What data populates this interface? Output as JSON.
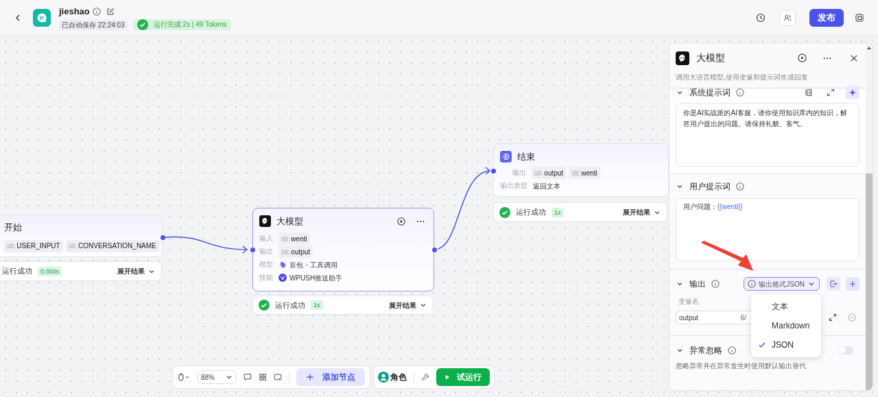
{
  "header": {
    "app_name": "jieshao",
    "autosave": "已自动保存 22:24:03",
    "run_status": "运行完成 2s | 49 Tokens",
    "publish": "发布"
  },
  "start_node": {
    "title": "开始",
    "selected": false,
    "vars": [
      {
        "type": "str.",
        "name": "USER_INPUT"
      },
      {
        "type": "str.",
        "name": "CONVERSATION_NAME"
      }
    ],
    "status": {
      "icon": false,
      "label": "运行成功",
      "time": "0.000s",
      "expand": "展开结果"
    }
  },
  "llm_node": {
    "title": "大模型",
    "selected": true,
    "rows": [
      {
        "label": "输入",
        "kind": "vars",
        "vars": [
          {
            "type": "str.",
            "name": "wenti"
          }
        ]
      },
      {
        "label": "输出",
        "kind": "vars",
        "vars": [
          {
            "type": "str.",
            "name": "output"
          }
        ]
      },
      {
        "label": "模型",
        "kind": "model",
        "text": "豆包・工具调用"
      },
      {
        "label": "技能",
        "kind": "skill",
        "text": "WPUSH推送助手"
      }
    ],
    "status": {
      "icon": true,
      "label": "运行成功",
      "time": "1s",
      "expand": "展开结果"
    }
  },
  "end_node": {
    "title": "结束",
    "selected": false,
    "rows": [
      {
        "label": "输出",
        "kind": "vars",
        "vars": [
          {
            "type": "str.",
            "name": "output"
          },
          {
            "type": "str.",
            "name": "wenti"
          }
        ]
      },
      {
        "label": "输出类型",
        "kind": "text",
        "text": "返回文本"
      }
    ],
    "status": {
      "icon": true,
      "label": "运行成功",
      "time": "1s",
      "expand": "展开结果"
    }
  },
  "panel": {
    "title": "大模型",
    "description": "调用大语言模型,使用变量和提示词生成回复",
    "system_prompt": {
      "title": "系统提示词",
      "expanded": true,
      "text": "你是AI实战派的AI客服，请你使用知识库内的知识，解答用户提出的问题。请保持礼貌、客气。"
    },
    "user_prompt": {
      "title": "用户提示词",
      "expanded": true,
      "prefix": "用户问题：",
      "variable": "{{wenti}}"
    },
    "output": {
      "title": "输出",
      "expanded": true,
      "format_button": "输出格式JSON",
      "column": "变量名",
      "variable": {
        "name": "output",
        "count": "6/"
      },
      "dropdown": [
        {
          "label": "文本",
          "selected": false
        },
        {
          "label": "Markdown",
          "selected": false
        },
        {
          "label": "JSON",
          "selected": true
        }
      ]
    },
    "exception": {
      "title": "异常忽略",
      "expanded": true,
      "on": false,
      "description": "忽略异常并在异常发生时使用默认输出替代"
    }
  },
  "toolbar": {
    "zoom": "88%",
    "add_node": "添加节点",
    "role": "角色",
    "test_run": "试运行"
  }
}
